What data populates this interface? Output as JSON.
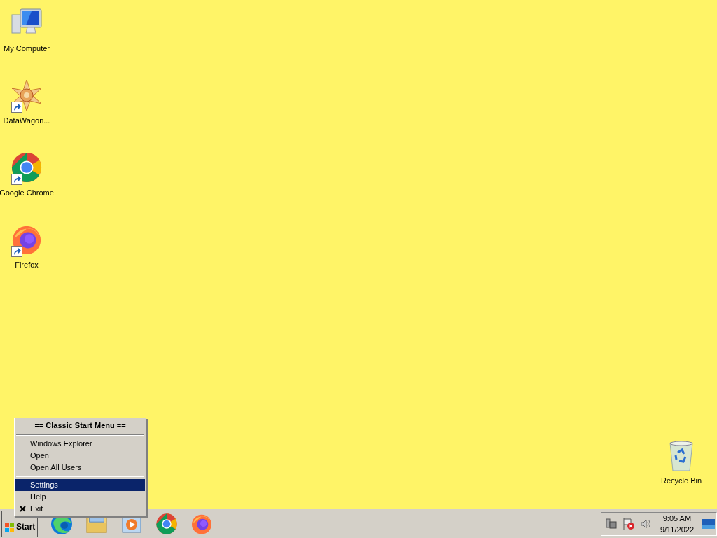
{
  "desktop_icons": [
    {
      "label": "My Computer",
      "kind": "computer",
      "shortcut": false
    },
    {
      "label": "DataWagon...",
      "kind": "star",
      "shortcut": true
    },
    {
      "label": "Google Chrome",
      "kind": "chrome",
      "shortcut": true
    },
    {
      "label": "Firefox",
      "kind": "firefox",
      "shortcut": true
    }
  ],
  "recycle_bin": {
    "label": "Recycle Bin"
  },
  "start_menu": {
    "title": "== Classic Start Menu ==",
    "groups": [
      [
        {
          "label": "Windows Explorer",
          "selected": false,
          "kind": "plain"
        },
        {
          "label": "Open",
          "selected": false,
          "kind": "plain"
        },
        {
          "label": "Open All Users",
          "selected": false,
          "kind": "plain"
        }
      ],
      [
        {
          "label": "Settings",
          "selected": true,
          "kind": "plain"
        },
        {
          "label": "Help",
          "selected": false,
          "kind": "plain"
        },
        {
          "label": "Exit",
          "selected": false,
          "kind": "exit"
        }
      ]
    ]
  },
  "taskbar": {
    "start_label": "Start",
    "apps": [
      {
        "kind": "edge"
      },
      {
        "kind": "folder"
      },
      {
        "kind": "media"
      },
      {
        "kind": "chrome"
      },
      {
        "kind": "firefox"
      }
    ],
    "tray": {
      "time": "9:05 AM",
      "date": "9/11/2022"
    }
  }
}
